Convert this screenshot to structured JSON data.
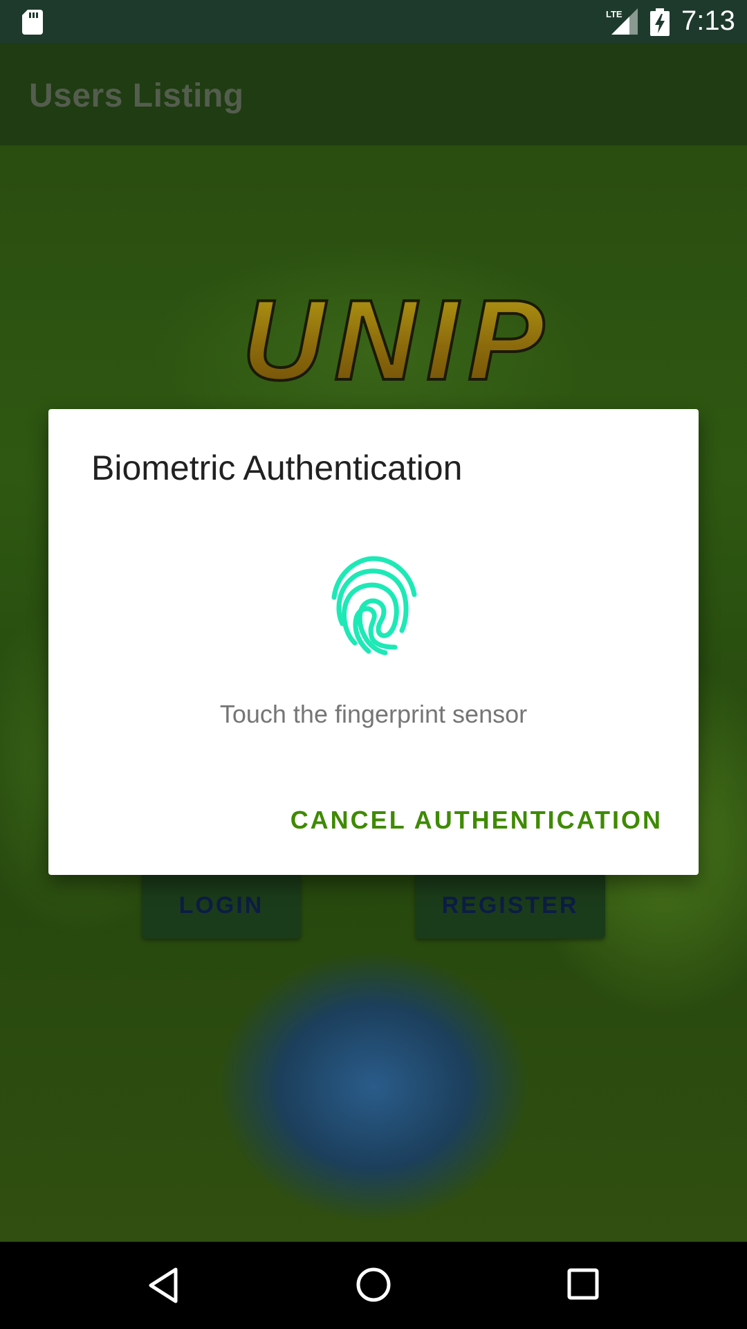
{
  "status_bar": {
    "time": "7:13",
    "network": "LTE",
    "icons": [
      "sd-card-icon",
      "lte-signal-icon",
      "battery-charging-icon"
    ]
  },
  "app_bar": {
    "title": "Users Listing"
  },
  "background": {
    "logo_text": "UNIP"
  },
  "buttons": {
    "login": "LOGIN",
    "register": "REGISTER"
  },
  "dialog": {
    "title": "Biometric Authentication",
    "icon": "fingerprint-icon",
    "message": "Touch the fingerprint sensor",
    "cancel_label": "CANCEL AUTHENTICATION"
  },
  "nav_bar": {
    "icons": [
      "back-icon",
      "home-icon",
      "recents-icon"
    ]
  },
  "colors": {
    "accent": "#3f8a00",
    "fingerprint": "#1de9b6",
    "status_bar": "#1e3a2c",
    "app_bar": "#1f3c12",
    "button_text": "#0c1d45"
  }
}
